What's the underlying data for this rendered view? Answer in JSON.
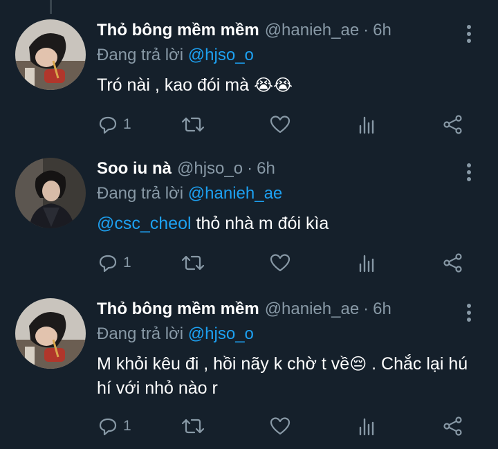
{
  "tweets": [
    {
      "display_name": "Thỏ bông mềm mềm",
      "handle": "@hanieh_ae",
      "dot": "·",
      "time": "6h",
      "reply_prefix": "Đang trả lời",
      "reply_to": "@hjso_o",
      "text_plain": "Tró nài , kao đói mà ",
      "text_emoji": "😭😭",
      "reply_count": "1"
    },
    {
      "display_name": "Soo iu nà",
      "handle": "@hjso_o",
      "dot": "·",
      "time": "6h",
      "reply_prefix": "Đang trả lời",
      "reply_to": "@hanieh_ae",
      "text_mention": "@csc_cheol",
      "text_plain": " thỏ nhà m đói kìa",
      "reply_count": "1"
    },
    {
      "display_name": "Thỏ bông mềm mềm",
      "handle": "@hanieh_ae",
      "dot": "·",
      "time": "6h",
      "reply_prefix": "Đang trả lời",
      "reply_to": "@hjso_o",
      "text_plain": "M khỏi kêu đi , hồi nãy k chờ t về",
      "text_emoji": "😔",
      "text_tail": " . Chắc lại hú hí với nhỏ nào r",
      "reply_count": "1"
    }
  ],
  "icons": {
    "reply": "reply-icon",
    "retweet": "retweet-icon",
    "like": "heart-icon",
    "analytics": "analytics-icon",
    "share": "share-icon",
    "more": "more-vertical-icon"
  },
  "colors": {
    "background": "#15202b",
    "secondary_text": "#8899a6",
    "link": "#1da1f2",
    "thread_line": "#38444d"
  }
}
